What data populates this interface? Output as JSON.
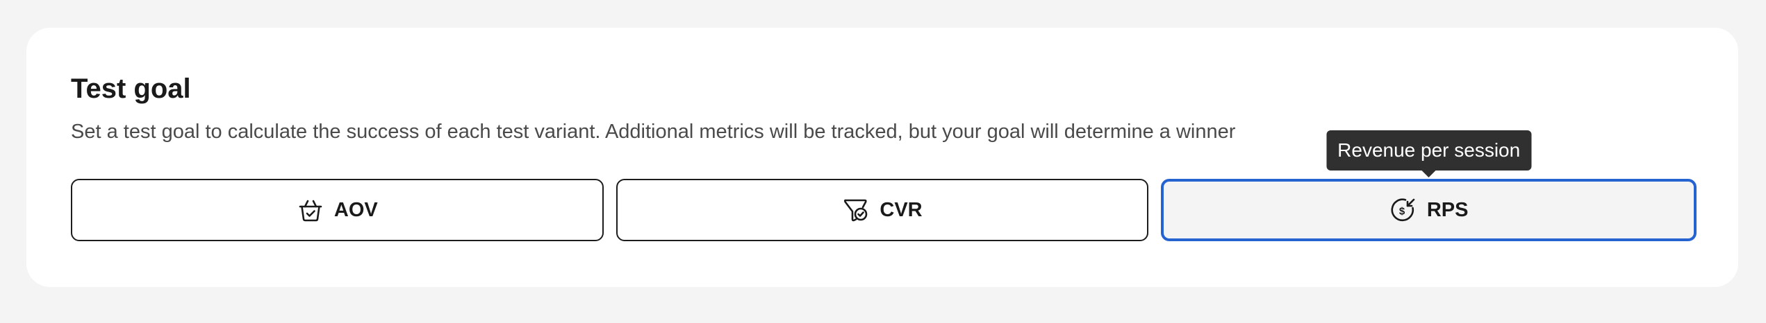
{
  "section": {
    "title": "Test goal",
    "description": "Set a test goal to calculate the success of each test variant. Additional metrics will be tracked, but your goal will determine a winner"
  },
  "options": [
    {
      "label": "AOV",
      "icon": "basket-check-icon",
      "selected": false
    },
    {
      "label": "CVR",
      "icon": "funnel-check-icon",
      "selected": false
    },
    {
      "label": "RPS",
      "icon": "dollar-refresh-icon",
      "selected": true
    }
  ],
  "tooltip": {
    "text": "Revenue per session"
  },
  "colors": {
    "selected_border": "#2463d0",
    "tooltip_bg": "#303030",
    "page_bg": "#f4f4f4"
  }
}
